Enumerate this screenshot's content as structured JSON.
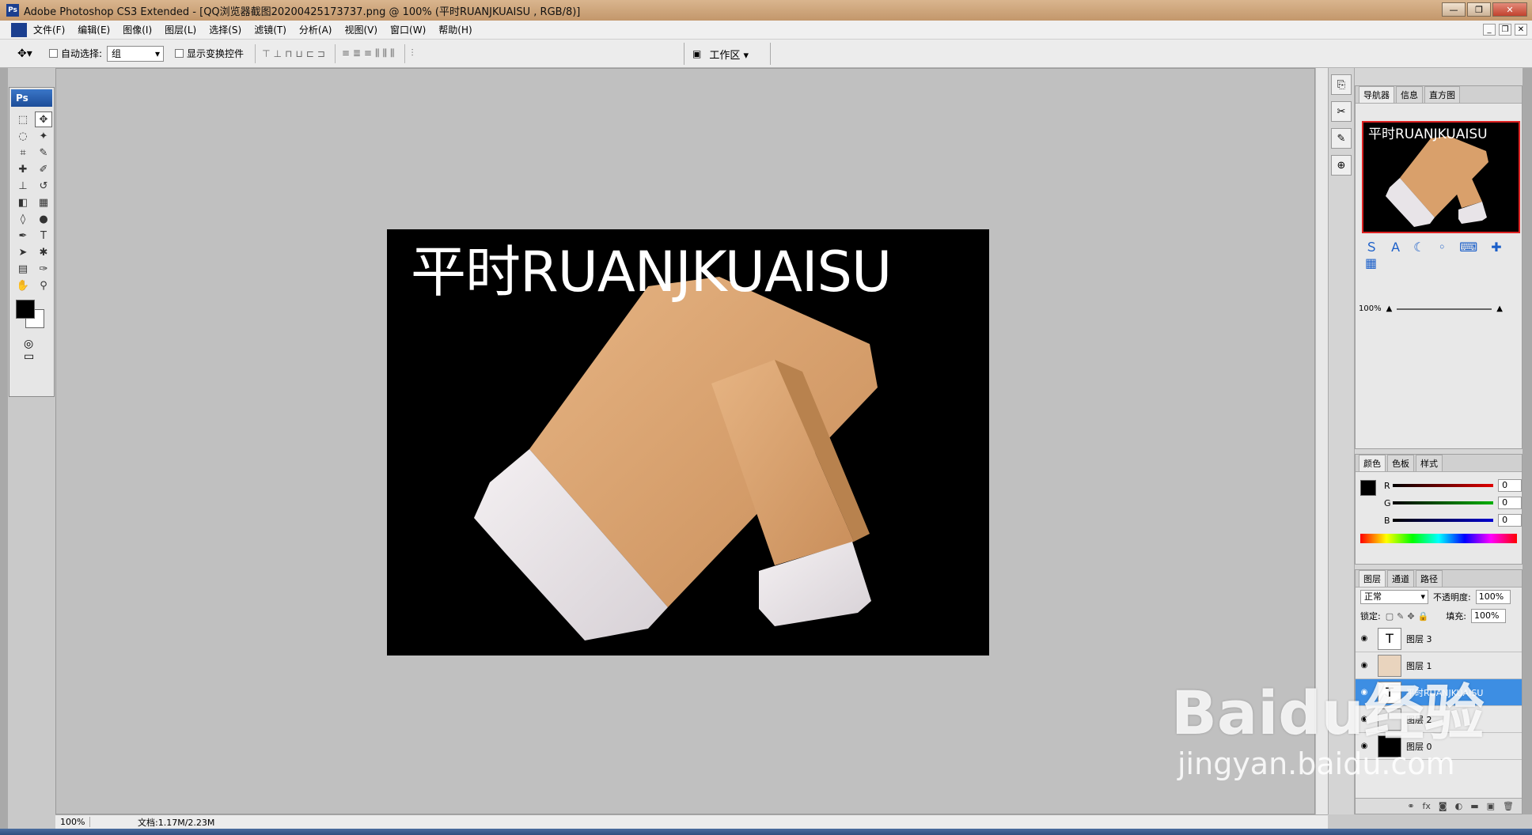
{
  "titlebar": {
    "title": "Adobe Photoshop CS3 Extended - [QQ浏览器截图20200425173737.png @ 100% (平时RUANJKUAISU , RGB/8)]",
    "ps_badge": "Ps"
  },
  "menu": [
    "文件(F)",
    "编辑(E)",
    "图像(I)",
    "图层(L)",
    "选择(S)",
    "滤镜(T)",
    "分析(A)",
    "视图(V)",
    "窗口(W)",
    "帮助(H)"
  ],
  "options": {
    "auto_select_label": "自动选择:",
    "auto_select_value": "组",
    "show_transform_label": "显示变换控件",
    "workspace_label": "工作区"
  },
  "toolbox": {
    "logo": "Ps"
  },
  "canvas": {
    "text_layer": "平时RUANJKUAISU"
  },
  "status": {
    "zoom": "100%",
    "doc_info": "文档:1.17M/2.23M"
  },
  "navigator": {
    "tabs": [
      "导航器",
      "信息",
      "直方图"
    ],
    "thumb_text": "平时RUANJKUAISU",
    "zoom": "100%"
  },
  "color_panel": {
    "tabs": [
      "颜色",
      "色板",
      "样式"
    ],
    "channels": [
      {
        "label": "R",
        "value": "0",
        "color": "#e00000"
      },
      {
        "label": "G",
        "value": "0",
        "color": "#00b000"
      },
      {
        "label": "B",
        "value": "0",
        "color": "#0000d0"
      }
    ]
  },
  "layers_panel": {
    "tabs": [
      "图层",
      "通道",
      "路径"
    ],
    "blend_mode": "正常",
    "opacity_label": "不透明度:",
    "opacity": "100%",
    "lock_label": "锁定:",
    "fill_label": "填充:",
    "fill": "100%",
    "layers": [
      {
        "name": "图层 3",
        "thumb": "T"
      },
      {
        "name": "图层 1",
        "thumb": ""
      },
      {
        "name": "平时RUANJKUAISU",
        "thumb": "T"
      },
      {
        "name": "图层 2",
        "thumb": ""
      },
      {
        "name": "图层 0",
        "thumb": ""
      }
    ]
  },
  "watermark": {
    "line1": "Baidu经验",
    "line2": "jingyan.baidu.com"
  }
}
